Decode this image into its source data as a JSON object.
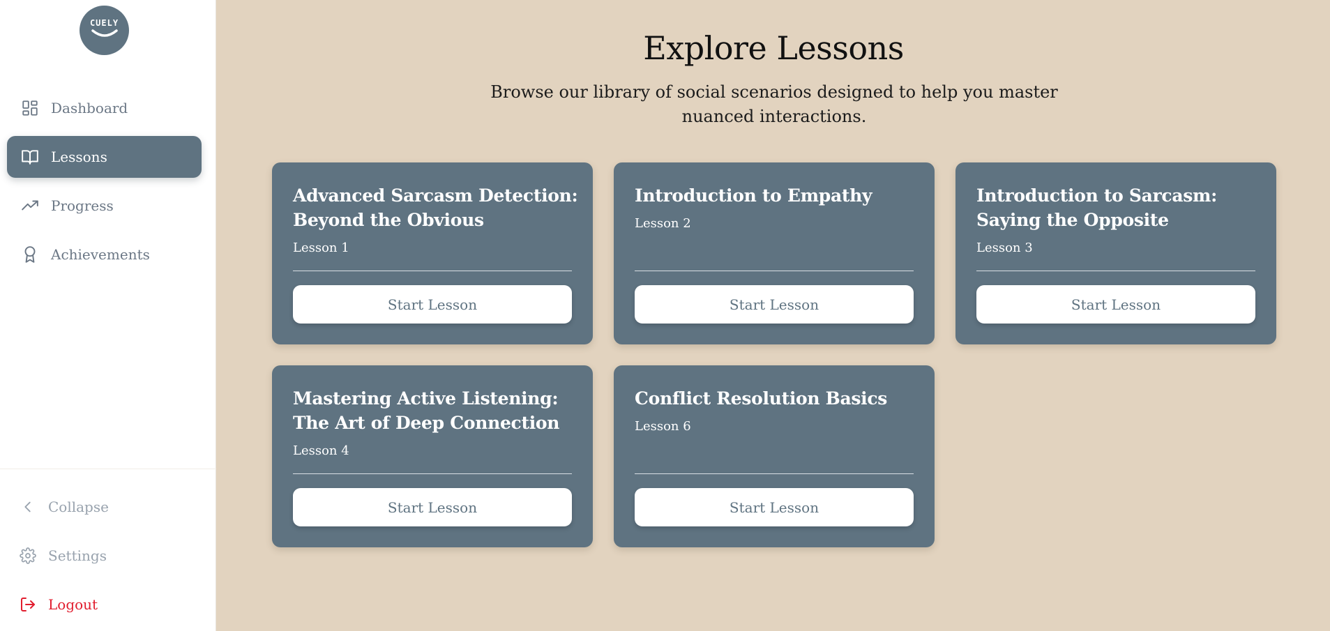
{
  "app": {
    "logo_text": "CUELY",
    "brand_color": "#5f7381",
    "background_color": "#e2d3bf",
    "logout_color": "#e11d2e"
  },
  "sidebar": {
    "items": [
      {
        "label": "Dashboard",
        "icon": "dashboard-icon",
        "active": false
      },
      {
        "label": "Lessons",
        "icon": "book-icon",
        "active": true
      },
      {
        "label": "Progress",
        "icon": "trending-up-icon",
        "active": false
      },
      {
        "label": "Achievements",
        "icon": "award-icon",
        "active": false
      }
    ],
    "bottom": {
      "collapse": "Collapse",
      "settings": "Settings",
      "logout": "Logout"
    }
  },
  "main": {
    "title": "Explore Lessons",
    "subtitle": "Browse our library of social scenarios designed to help you master nuanced interactions.",
    "lessons": [
      {
        "title": "Advanced Sarcasm Detection: Beyond the Obvious",
        "subtitle": "Lesson 1",
        "button": "Start Lesson"
      },
      {
        "title": "Introduction to Empathy",
        "subtitle": "Lesson 2",
        "button": "Start Lesson"
      },
      {
        "title": "Introduction to Sarcasm: Saying the Opposite",
        "subtitle": "Lesson 3",
        "button": "Start Lesson"
      },
      {
        "title": "Mastering Active Listening: The Art of Deep Connection",
        "subtitle": "Lesson 4",
        "button": "Start Lesson"
      },
      {
        "title": "Conflict Resolution Basics",
        "subtitle": "Lesson 6",
        "button": "Start Lesson"
      }
    ]
  }
}
